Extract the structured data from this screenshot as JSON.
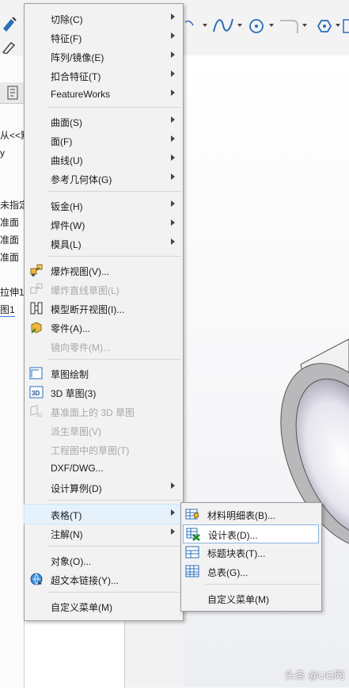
{
  "main_menu": {
    "items": [
      {
        "label": "切除(C)",
        "submenu": true
      },
      {
        "label": "特征(F)",
        "submenu": true
      },
      {
        "label": "阵列/镜像(E)",
        "submenu": true
      },
      {
        "label": "扣合特征(T)",
        "submenu": true
      },
      {
        "label": "FeatureWorks",
        "submenu": true
      },
      {
        "label": "曲面(S)",
        "submenu": true
      },
      {
        "label": "面(F)",
        "submenu": true
      },
      {
        "label": "曲线(U)",
        "submenu": true
      },
      {
        "label": "参考几何体(G)",
        "submenu": true
      },
      {
        "label": "钣金(H)",
        "submenu": true
      },
      {
        "label": "焊件(W)",
        "submenu": true
      },
      {
        "label": "模具(L)",
        "submenu": true
      },
      {
        "label": "爆炸视图(V)...",
        "icon": "explode-view-icon"
      },
      {
        "label": "爆炸直线草图(L)",
        "icon": "explode-line-sketch-icon",
        "disabled": true
      },
      {
        "label": "模型断开视图(I)...",
        "icon": "break-view-icon"
      },
      {
        "label": "零件(A)...",
        "icon": "part-icon"
      },
      {
        "label": "镜向零件(M)...",
        "disabled": true
      },
      {
        "label": "草图绘制",
        "icon": "sketch-icon"
      },
      {
        "label": "3D 草图(3)",
        "icon": "3d-sketch-icon"
      },
      {
        "label": "基准面上的 3D 草图",
        "icon": "3d-sketch-on-plane-icon",
        "disabled": true
      },
      {
        "label": "派生草图(V)",
        "disabled": true
      },
      {
        "label": "工程图中的草图(T)",
        "disabled": true
      },
      {
        "label": "DXF/DWG..."
      },
      {
        "label": "设计算例(D)",
        "submenu": true
      },
      {
        "label": "表格(T)",
        "submenu": true,
        "active": true
      },
      {
        "label": "注解(N)",
        "submenu": true
      },
      {
        "label": "对象(O)..."
      },
      {
        "label": "超文本链接(Y)...",
        "icon": "hyperlink-icon"
      },
      {
        "label": "自定义菜单(M)"
      }
    ]
  },
  "sub_menu": {
    "items": [
      {
        "label": "材料明细表(B)...",
        "icon": "bom-table-icon"
      },
      {
        "label": "设计表(D)...",
        "icon": "design-table-icon",
        "highlighted": true
      },
      {
        "label": "标题块表(T)...",
        "icon": "title-block-table-icon"
      },
      {
        "label": "总表(G)...",
        "icon": "general-table-icon"
      },
      {
        "label": "自定义菜单(M)"
      }
    ]
  },
  "feature_tree": {
    "lines": [
      "从<<默",
      "y",
      "未指定",
      "准面",
      "准面",
      "准面",
      "拉伸1",
      "图1"
    ]
  },
  "watermark": "头条 @UG网",
  "colors": {
    "menu_bg": "#f2f2f2",
    "highlight_border": "#8ab4dc",
    "disabled_text": "#a8a8a8",
    "part_gray": "#b9b9bb"
  }
}
